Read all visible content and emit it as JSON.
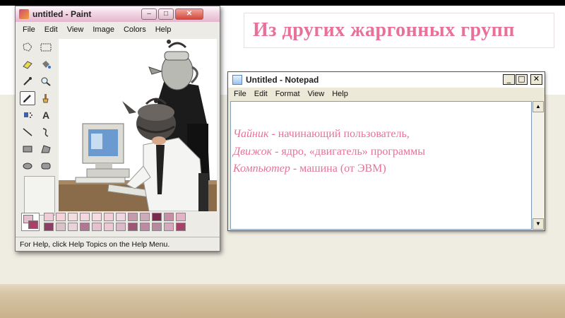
{
  "slide": {
    "title": "Из других жаргонных групп"
  },
  "paint": {
    "title": "untitled - Paint",
    "menu": [
      "File",
      "Edit",
      "View",
      "Image",
      "Colors",
      "Help"
    ],
    "status": "For Help, click Help Topics on the Help Menu.",
    "palette_colors": [
      "#f0cdd8",
      "#f6d3db",
      "#f2dede",
      "#f3d6e0",
      "#f7dbe3",
      "#f3cfda",
      "#efd6e0",
      "#c49aac",
      "#cfaab8",
      "#7a2a4e",
      "#c88ea8",
      "#e3b3c5",
      "#8c3f65",
      "#d9c2c9",
      "#e9d2d8",
      "#b07792",
      "#e6c0cf",
      "#ebc9d5",
      "#dcb9c8",
      "#9c5678",
      "#bd8aa3",
      "#b58aa0",
      "#d6a9bd",
      "#a8406a"
    ]
  },
  "notepad": {
    "title": "Untitled - Notepad",
    "menu": [
      "File",
      "Edit",
      "Format",
      "View",
      "Help"
    ],
    "lines": [
      {
        "term": "Чайник",
        "definition": " - начинающий пользователь,"
      },
      {
        "term": "Движок",
        "definition": " - ядро, «двигатель» программы"
      },
      {
        "term": "Компьютер",
        "definition": " -  машина (от ЭВМ)"
      }
    ]
  },
  "colors": {
    "accent_pink": "#e8719c"
  }
}
